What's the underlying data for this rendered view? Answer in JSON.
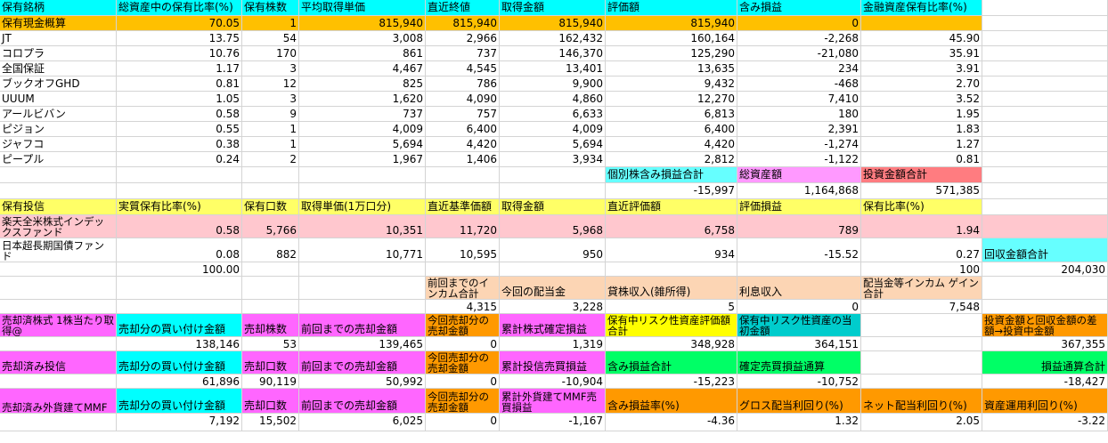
{
  "palette": {
    "cyan": "#00ffff",
    "orange_header": "#ffc000",
    "yellow": "#ffff66",
    "pink": "#ffc7ce",
    "peach": "#fcd5b4",
    "magenta": "#ff66ff",
    "bright_yellow": "#ffff00",
    "teal": "#00cccc",
    "orange": "#ff9900",
    "green": "#00ff66",
    "light_magenta": "#ff99ff",
    "red_salmon": "#ff7c80",
    "light_cyan": "#66ffff"
  },
  "cells": [
    {
      "r": 0,
      "c": 0,
      "t": "保有銘柄",
      "bg": "cyan"
    },
    {
      "r": 0,
      "c": 1,
      "t": "総資産中の保有比率(%)",
      "bg": "cyan"
    },
    {
      "r": 0,
      "c": 2,
      "t": "保有株数",
      "bg": "cyan"
    },
    {
      "r": 0,
      "c": 3,
      "t": "平均取得単価",
      "bg": "cyan"
    },
    {
      "r": 0,
      "c": 4,
      "t": "直近終値",
      "bg": "cyan"
    },
    {
      "r": 0,
      "c": 5,
      "t": "取得金額",
      "bg": "cyan"
    },
    {
      "r": 0,
      "c": 6,
      "t": "評価額",
      "bg": "cyan"
    },
    {
      "r": 0,
      "c": 7,
      "t": "含み損益",
      "bg": "cyan"
    },
    {
      "r": 0,
      "c": 8,
      "t": "金融資産保有比率(%)",
      "bg": "cyan"
    },
    {
      "r": 1,
      "c": 0,
      "t": "保有現金概算",
      "bg": "orange_header"
    },
    {
      "r": 1,
      "c": 1,
      "t": "70.05",
      "n": 1,
      "bg": "orange_header"
    },
    {
      "r": 1,
      "c": 2,
      "t": "1",
      "n": 1,
      "bg": "orange_header"
    },
    {
      "r": 1,
      "c": 3,
      "t": "815,940",
      "n": 1,
      "bg": "orange_header"
    },
    {
      "r": 1,
      "c": 4,
      "t": "815,940",
      "n": 1,
      "bg": "orange_header"
    },
    {
      "r": 1,
      "c": 5,
      "t": "815,940",
      "n": 1,
      "bg": "orange_header"
    },
    {
      "r": 1,
      "c": 6,
      "t": "815,940",
      "n": 1,
      "bg": "orange_header"
    },
    {
      "r": 1,
      "c": 7,
      "t": "0",
      "n": 1,
      "bg": "orange_header"
    },
    {
      "r": 1,
      "c": 8,
      "t": "",
      "bg": "orange_header"
    },
    {
      "r": 2,
      "c": 0,
      "t": "JT"
    },
    {
      "r": 2,
      "c": 1,
      "t": "13.75",
      "n": 1
    },
    {
      "r": 2,
      "c": 2,
      "t": "54",
      "n": 1
    },
    {
      "r": 2,
      "c": 3,
      "t": "3,008",
      "n": 1
    },
    {
      "r": 2,
      "c": 4,
      "t": "2,966",
      "n": 1
    },
    {
      "r": 2,
      "c": 5,
      "t": "162,432",
      "n": 1
    },
    {
      "r": 2,
      "c": 6,
      "t": "160,164",
      "n": 1
    },
    {
      "r": 2,
      "c": 7,
      "t": "-2,268",
      "n": 1
    },
    {
      "r": 2,
      "c": 8,
      "t": "45.90",
      "n": 1
    },
    {
      "r": 3,
      "c": 0,
      "t": "コロプラ"
    },
    {
      "r": 3,
      "c": 1,
      "t": "10.76",
      "n": 1
    },
    {
      "r": 3,
      "c": 2,
      "t": "170",
      "n": 1
    },
    {
      "r": 3,
      "c": 3,
      "t": "861",
      "n": 1
    },
    {
      "r": 3,
      "c": 4,
      "t": "737",
      "n": 1
    },
    {
      "r": 3,
      "c": 5,
      "t": "146,370",
      "n": 1
    },
    {
      "r": 3,
      "c": 6,
      "t": "125,290",
      "n": 1
    },
    {
      "r": 3,
      "c": 7,
      "t": "-21,080",
      "n": 1
    },
    {
      "r": 3,
      "c": 8,
      "t": "35.91",
      "n": 1
    },
    {
      "r": 4,
      "c": 0,
      "t": "全国保証"
    },
    {
      "r": 4,
      "c": 1,
      "t": "1.17",
      "n": 1
    },
    {
      "r": 4,
      "c": 2,
      "t": "3",
      "n": 1
    },
    {
      "r": 4,
      "c": 3,
      "t": "4,467",
      "n": 1
    },
    {
      "r": 4,
      "c": 4,
      "t": "4,545",
      "n": 1
    },
    {
      "r": 4,
      "c": 5,
      "t": "13,401",
      "n": 1
    },
    {
      "r": 4,
      "c": 6,
      "t": "13,635",
      "n": 1
    },
    {
      "r": 4,
      "c": 7,
      "t": "234",
      "n": 1
    },
    {
      "r": 4,
      "c": 8,
      "t": "3.91",
      "n": 1
    },
    {
      "r": 5,
      "c": 0,
      "t": "ブックオフGHD"
    },
    {
      "r": 5,
      "c": 1,
      "t": "0.81",
      "n": 1
    },
    {
      "r": 5,
      "c": 2,
      "t": "12",
      "n": 1
    },
    {
      "r": 5,
      "c": 3,
      "t": "825",
      "n": 1
    },
    {
      "r": 5,
      "c": 4,
      "t": "786",
      "n": 1
    },
    {
      "r": 5,
      "c": 5,
      "t": "9,900",
      "n": 1
    },
    {
      "r": 5,
      "c": 6,
      "t": "9,432",
      "n": 1
    },
    {
      "r": 5,
      "c": 7,
      "t": "-468",
      "n": 1
    },
    {
      "r": 5,
      "c": 8,
      "t": "2.70",
      "n": 1
    },
    {
      "r": 6,
      "c": 0,
      "t": "UUUM"
    },
    {
      "r": 6,
      "c": 1,
      "t": "1.05",
      "n": 1
    },
    {
      "r": 6,
      "c": 2,
      "t": "3",
      "n": 1
    },
    {
      "r": 6,
      "c": 3,
      "t": "1,620",
      "n": 1
    },
    {
      "r": 6,
      "c": 4,
      "t": "4,090",
      "n": 1
    },
    {
      "r": 6,
      "c": 5,
      "t": "4,860",
      "n": 1
    },
    {
      "r": 6,
      "c": 6,
      "t": "12,270",
      "n": 1
    },
    {
      "r": 6,
      "c": 7,
      "t": "7,410",
      "n": 1
    },
    {
      "r": 6,
      "c": 8,
      "t": "3.52",
      "n": 1
    },
    {
      "r": 7,
      "c": 0,
      "t": "アールビバン"
    },
    {
      "r": 7,
      "c": 1,
      "t": "0.58",
      "n": 1
    },
    {
      "r": 7,
      "c": 2,
      "t": "9",
      "n": 1
    },
    {
      "r": 7,
      "c": 3,
      "t": "737",
      "n": 1
    },
    {
      "r": 7,
      "c": 4,
      "t": "757",
      "n": 1
    },
    {
      "r": 7,
      "c": 5,
      "t": "6,633",
      "n": 1
    },
    {
      "r": 7,
      "c": 6,
      "t": "6,813",
      "n": 1
    },
    {
      "r": 7,
      "c": 7,
      "t": "180",
      "n": 1
    },
    {
      "r": 7,
      "c": 8,
      "t": "1.95",
      "n": 1
    },
    {
      "r": 8,
      "c": 0,
      "t": "ピジョン"
    },
    {
      "r": 8,
      "c": 1,
      "t": "0.55",
      "n": 1
    },
    {
      "r": 8,
      "c": 2,
      "t": "1",
      "n": 1
    },
    {
      "r": 8,
      "c": 3,
      "t": "4,009",
      "n": 1
    },
    {
      "r": 8,
      "c": 4,
      "t": "6,400",
      "n": 1
    },
    {
      "r": 8,
      "c": 5,
      "t": "4,009",
      "n": 1
    },
    {
      "r": 8,
      "c": 6,
      "t": "6,400",
      "n": 1
    },
    {
      "r": 8,
      "c": 7,
      "t": "2,391",
      "n": 1
    },
    {
      "r": 8,
      "c": 8,
      "t": "1.83",
      "n": 1
    },
    {
      "r": 9,
      "c": 0,
      "t": "ジャフコ"
    },
    {
      "r": 9,
      "c": 1,
      "t": "0.38",
      "n": 1
    },
    {
      "r": 9,
      "c": 2,
      "t": "1",
      "n": 1
    },
    {
      "r": 9,
      "c": 3,
      "t": "5,694",
      "n": 1
    },
    {
      "r": 9,
      "c": 4,
      "t": "4,420",
      "n": 1
    },
    {
      "r": 9,
      "c": 5,
      "t": "5,694",
      "n": 1
    },
    {
      "r": 9,
      "c": 6,
      "t": "4,420",
      "n": 1
    },
    {
      "r": 9,
      "c": 7,
      "t": "-1,274",
      "n": 1
    },
    {
      "r": 9,
      "c": 8,
      "t": "1.27",
      "n": 1
    },
    {
      "r": 10,
      "c": 0,
      "t": "ピープル"
    },
    {
      "r": 10,
      "c": 1,
      "t": "0.24",
      "n": 1
    },
    {
      "r": 10,
      "c": 2,
      "t": "2",
      "n": 1
    },
    {
      "r": 10,
      "c": 3,
      "t": "1,967",
      "n": 1
    },
    {
      "r": 10,
      "c": 4,
      "t": "1,406",
      "n": 1
    },
    {
      "r": 10,
      "c": 5,
      "t": "3,934",
      "n": 1
    },
    {
      "r": 10,
      "c": 6,
      "t": "2,812",
      "n": 1
    },
    {
      "r": 10,
      "c": 7,
      "t": "-1,122",
      "n": 1
    },
    {
      "r": 10,
      "c": 8,
      "t": "0.81",
      "n": 1
    },
    {
      "r": 11,
      "c": 6,
      "t": "個別株含み損益合計",
      "bg": "light_cyan"
    },
    {
      "r": 11,
      "c": 7,
      "t": "総資産額",
      "bg": "light_magenta"
    },
    {
      "r": 11,
      "c": 8,
      "t": "投資金額合計",
      "bg": "red_salmon"
    },
    {
      "r": 12,
      "c": 6,
      "t": "-15,997",
      "n": 1
    },
    {
      "r": 12,
      "c": 7,
      "t": "1,164,868",
      "n": 1
    },
    {
      "r": 12,
      "c": 8,
      "t": "571,385",
      "n": 1
    },
    {
      "r": 13,
      "c": 0,
      "t": "保有投信",
      "bg": "yellow"
    },
    {
      "r": 13,
      "c": 1,
      "t": "実質保有比率(%)",
      "bg": "yellow"
    },
    {
      "r": 13,
      "c": 2,
      "t": "保有口数",
      "bg": "yellow"
    },
    {
      "r": 13,
      "c": 3,
      "t": "取得単価(1万口分)",
      "bg": "yellow"
    },
    {
      "r": 13,
      "c": 4,
      "t": "直近基準価額",
      "bg": "yellow"
    },
    {
      "r": 13,
      "c": 5,
      "t": "取得金額",
      "bg": "yellow"
    },
    {
      "r": 13,
      "c": 6,
      "t": "直近評価額",
      "bg": "yellow"
    },
    {
      "r": 13,
      "c": 7,
      "t": "評価損益",
      "bg": "yellow"
    },
    {
      "r": 13,
      "c": 8,
      "t": "保有比率(%)",
      "bg": "yellow"
    },
    {
      "r": 14,
      "c": 0,
      "t": "楽天全米株式インデックスファンド",
      "bg": "pink",
      "w": 1
    },
    {
      "r": 14,
      "c": 1,
      "t": "0.58",
      "n": 1,
      "bg": "pink"
    },
    {
      "r": 14,
      "c": 2,
      "t": "5,766",
      "n": 1,
      "bg": "pink"
    },
    {
      "r": 14,
      "c": 3,
      "t": "10,351",
      "n": 1,
      "bg": "pink"
    },
    {
      "r": 14,
      "c": 4,
      "t": "11,720",
      "n": 1,
      "bg": "pink"
    },
    {
      "r": 14,
      "c": 5,
      "t": "5,968",
      "n": 1,
      "bg": "pink"
    },
    {
      "r": 14,
      "c": 6,
      "t": "6,758",
      "n": 1,
      "bg": "pink"
    },
    {
      "r": 14,
      "c": 7,
      "t": "789",
      "n": 1,
      "bg": "pink"
    },
    {
      "r": 14,
      "c": 8,
      "t": "1.94",
      "n": 1,
      "bg": "pink"
    },
    {
      "r": 14,
      "c": 9,
      "t": "",
      "bg": "pink"
    },
    {
      "r": 15,
      "c": 0,
      "t": "日本超長期国債ファンド",
      "w": 1
    },
    {
      "r": 15,
      "c": 1,
      "t": "0.08",
      "n": 1
    },
    {
      "r": 15,
      "c": 2,
      "t": "882",
      "n": 1
    },
    {
      "r": 15,
      "c": 3,
      "t": "10,771",
      "n": 1
    },
    {
      "r": 15,
      "c": 4,
      "t": "10,595",
      "n": 1
    },
    {
      "r": 15,
      "c": 5,
      "t": "950",
      "n": 1
    },
    {
      "r": 15,
      "c": 6,
      "t": "934",
      "n": 1
    },
    {
      "r": 15,
      "c": 7,
      "t": "-15.52",
      "n": 1
    },
    {
      "r": 15,
      "c": 8,
      "t": "0.27",
      "n": 1
    },
    {
      "r": 15,
      "c": 9,
      "t": "回収金額合計",
      "bg": "light_cyan"
    },
    {
      "r": 16,
      "c": 1,
      "t": "100.00",
      "n": 1
    },
    {
      "r": 16,
      "c": 8,
      "t": "100",
      "n": 1
    },
    {
      "r": 16,
      "c": 9,
      "t": "204,030",
      "n": 1
    },
    {
      "r": 17,
      "c": 4,
      "t": "前回までのインカム合計",
      "bg": "peach",
      "w": 1
    },
    {
      "r": 17,
      "c": 5,
      "t": "今回の配当金",
      "bg": "peach"
    },
    {
      "r": 17,
      "c": 6,
      "t": "貸株収入(雑所得)",
      "bg": "peach"
    },
    {
      "r": 17,
      "c": 7,
      "t": "利息収入",
      "bg": "peach"
    },
    {
      "r": 17,
      "c": 8,
      "t": "配当金等インカム ゲイン合計",
      "bg": "peach",
      "w": 1
    },
    {
      "r": 18,
      "c": 4,
      "t": "4,315",
      "n": 1
    },
    {
      "r": 18,
      "c": 5,
      "t": "3,228",
      "n": 1
    },
    {
      "r": 18,
      "c": 6,
      "t": "5",
      "n": 1
    },
    {
      "r": 18,
      "c": 7,
      "t": "0",
      "n": 1
    },
    {
      "r": 18,
      "c": 8,
      "t": "7,548",
      "n": 1
    },
    {
      "r": 19,
      "c": 0,
      "t": "売却済株式 1株当たり取得@",
      "bg": "magenta",
      "w": 1
    },
    {
      "r": 19,
      "c": 1,
      "t": "売却分の買い付け金額",
      "bg": "cyan"
    },
    {
      "r": 19,
      "c": 2,
      "t": "売却株数",
      "bg": "magenta"
    },
    {
      "r": 19,
      "c": 3,
      "t": "前回までの売却金額",
      "bg": "magenta"
    },
    {
      "r": 19,
      "c": 4,
      "t": "今回売却分の売却金額",
      "bg": "orange",
      "w": 1
    },
    {
      "r": 19,
      "c": 5,
      "t": "累計株式確定損益",
      "bg": "magenta"
    },
    {
      "r": 19,
      "c": 6,
      "t": "保有中リスク性資産評価額合計",
      "bg": "bright_yellow",
      "w": 1
    },
    {
      "r": 19,
      "c": 7,
      "t": "保有中リスク性資産の当初金額",
      "bg": "teal",
      "w": 1
    },
    {
      "r": 19,
      "c": 9,
      "t": "投資金額と回収金額の差額→投資中金額",
      "bg": "orange",
      "w": 1
    },
    {
      "r": 20,
      "c": 1,
      "t": "138,146",
      "n": 1
    },
    {
      "r": 20,
      "c": 2,
      "t": "53",
      "n": 1
    },
    {
      "r": 20,
      "c": 3,
      "t": "139,465",
      "n": 1
    },
    {
      "r": 20,
      "c": 4,
      "t": "0",
      "n": 1
    },
    {
      "r": 20,
      "c": 5,
      "t": "1,319",
      "n": 1
    },
    {
      "r": 20,
      "c": 6,
      "t": "348,928",
      "n": 1
    },
    {
      "r": 20,
      "c": 7,
      "t": "364,151",
      "n": 1
    },
    {
      "r": 20,
      "c": 9,
      "t": "367,355",
      "n": 1
    },
    {
      "r": 21,
      "c": 0,
      "t": "売却済み投信",
      "bg": "magenta"
    },
    {
      "r": 21,
      "c": 1,
      "t": "売却分の買い付け金額",
      "bg": "cyan"
    },
    {
      "r": 21,
      "c": 2,
      "t": "売却口数",
      "bg": "magenta"
    },
    {
      "r": 21,
      "c": 3,
      "t": "前回までの売却金額",
      "bg": "magenta"
    },
    {
      "r": 21,
      "c": 4,
      "t": "今回売却分の売却金額",
      "bg": "orange",
      "w": 1
    },
    {
      "r": 21,
      "c": 5,
      "t": "累計投信売買損益",
      "bg": "magenta"
    },
    {
      "r": 21,
      "c": 6,
      "t": "含み損益合計",
      "bg": "green"
    },
    {
      "r": 21,
      "c": 7,
      "t": "確定売買損益通算",
      "bg": "green"
    },
    {
      "r": 21,
      "c": 9,
      "t": "損益通算合計",
      "bg": "green",
      "n": 1
    },
    {
      "r": 22,
      "c": 1,
      "t": "61,896",
      "n": 1
    },
    {
      "r": 22,
      "c": 2,
      "t": "90,119",
      "n": 1
    },
    {
      "r": 22,
      "c": 3,
      "t": "50,992",
      "n": 1
    },
    {
      "r": 22,
      "c": 4,
      "t": "0",
      "n": 1
    },
    {
      "r": 22,
      "c": 5,
      "t": "-10,904",
      "n": 1
    },
    {
      "r": 22,
      "c": 6,
      "t": "-15,223",
      "n": 1
    },
    {
      "r": 22,
      "c": 7,
      "t": "-10,752",
      "n": 1
    },
    {
      "r": 22,
      "c": 9,
      "t": "-18,427",
      "n": 1
    },
    {
      "r": 23,
      "c": 0,
      "t": "売却済み外貨建てMMF",
      "bg": "magenta",
      "w": 1
    },
    {
      "r": 23,
      "c": 1,
      "t": "売却分の買い付け金額",
      "bg": "cyan"
    },
    {
      "r": 23,
      "c": 2,
      "t": "売却口数",
      "bg": "magenta"
    },
    {
      "r": 23,
      "c": 3,
      "t": "前回までの売却金額",
      "bg": "magenta"
    },
    {
      "r": 23,
      "c": 4,
      "t": "今回売却分の売却金額",
      "bg": "orange",
      "w": 1
    },
    {
      "r": 23,
      "c": 5,
      "t": "累計外貨建てMMF売買損益",
      "bg": "magenta",
      "w": 1
    },
    {
      "r": 23,
      "c": 6,
      "t": "含み損益率(%)",
      "bg": "orange"
    },
    {
      "r": 23,
      "c": 7,
      "t": "グロス配当利回り(%)",
      "bg": "orange"
    },
    {
      "r": 23,
      "c": 8,
      "t": "ネット配当利回り(%)",
      "bg": "orange"
    },
    {
      "r": 23,
      "c": 9,
      "t": "資産運用利回り(%)",
      "bg": "orange"
    },
    {
      "r": 24,
      "c": 1,
      "t": "7,192",
      "n": 1
    },
    {
      "r": 24,
      "c": 2,
      "t": "15,502",
      "n": 1
    },
    {
      "r": 24,
      "c": 3,
      "t": "6,025",
      "n": 1
    },
    {
      "r": 24,
      "c": 4,
      "t": "0",
      "n": 1
    },
    {
      "r": 24,
      "c": 5,
      "t": "-1,167",
      "n": 1
    },
    {
      "r": 24,
      "c": 6,
      "t": "-4.36",
      "n": 1
    },
    {
      "r": 24,
      "c": 7,
      "t": "1.32",
      "n": 1
    },
    {
      "r": 24,
      "c": 8,
      "t": "2.05",
      "n": 1
    },
    {
      "r": 24,
      "c": 9,
      "t": "-3.22",
      "n": 1
    }
  ]
}
